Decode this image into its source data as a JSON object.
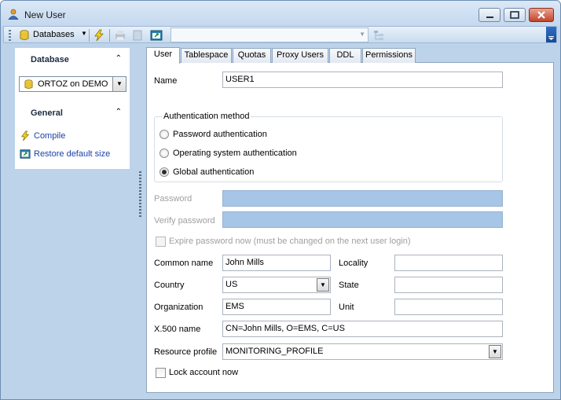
{
  "window": {
    "title": "New User"
  },
  "toolbar": {
    "databases_label": "Databases",
    "search_value": ""
  },
  "left_panel": {
    "database_header": "Database",
    "selected_database": "ORTOZ on DEMO",
    "general_header": "General",
    "links": [
      {
        "label": "Compile",
        "icon": "lightning-icon"
      },
      {
        "label": "Restore default size",
        "icon": "restore-size-icon"
      }
    ]
  },
  "tabs": [
    {
      "label": "User",
      "active": true
    },
    {
      "label": "Tablespace",
      "active": false
    },
    {
      "label": "Quotas",
      "active": false
    },
    {
      "label": "Proxy Users",
      "active": false
    },
    {
      "label": "DDL",
      "active": false
    },
    {
      "label": "Permissions",
      "active": false
    }
  ],
  "form": {
    "name_label": "Name",
    "name_value": "USER1",
    "auth_group_title": "Authentication method",
    "auth_options": [
      {
        "label": "Password authentication",
        "checked": false
      },
      {
        "label": "Operating system authentication",
        "checked": false
      },
      {
        "label": "Global authentication",
        "checked": true
      }
    ],
    "password_label": "Password",
    "password_value": "",
    "verify_password_label": "Verify password",
    "verify_password_value": "",
    "expire_label": "Expire password now (must be changed on the next user login)",
    "expire_checked": false,
    "common_name_label": "Common name",
    "common_name_value": "John Mills",
    "locality_label": "Locality",
    "locality_value": "",
    "country_label": "Country",
    "country_value": "US",
    "state_label": "State",
    "state_value": "",
    "organization_label": "Organization",
    "organization_value": "EMS",
    "unit_label": "Unit",
    "unit_value": "",
    "x500_label": "X.500 name",
    "x500_value": "CN=John Mills, O=EMS, C=US",
    "resource_profile_label": "Resource profile",
    "resource_profile_value": "MONITORING_PROFILE",
    "lock_label": "Lock account now",
    "lock_checked": false
  },
  "colors": {
    "window_frame": "#bcd3ea",
    "disabled_input": "#a7c5e6",
    "link": "#1a3fa8",
    "close_button": "#c4432a"
  }
}
